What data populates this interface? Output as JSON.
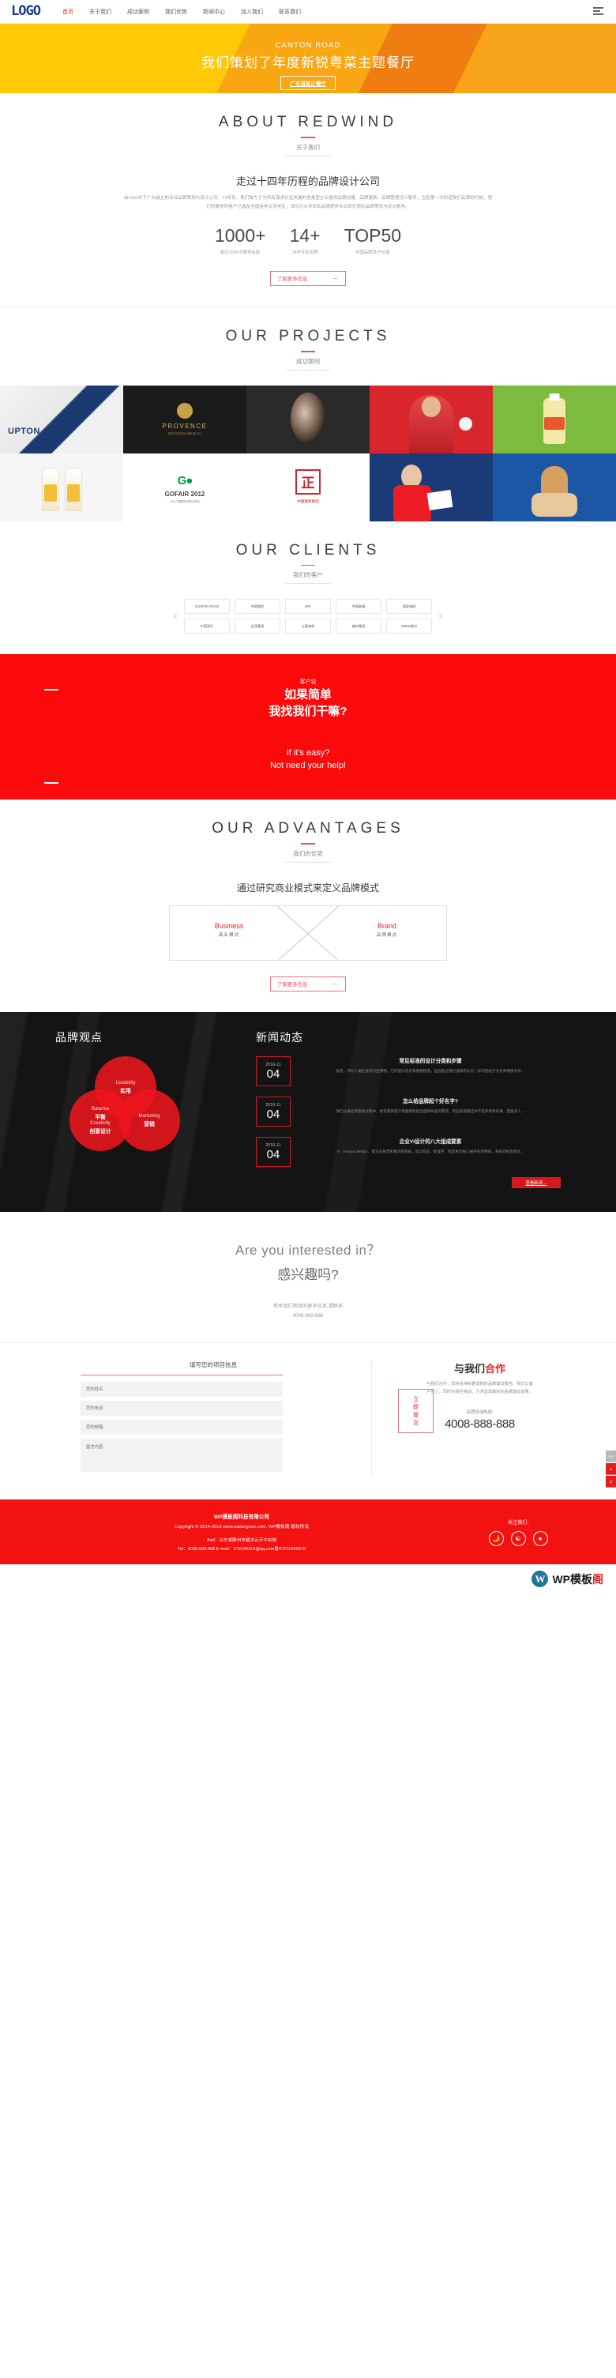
{
  "header": {
    "logo": "LOGO",
    "nav": [
      {
        "label": "首页",
        "active": true
      },
      {
        "label": "关于我们",
        "active": false
      },
      {
        "label": "成功案例",
        "active": false
      },
      {
        "label": "我们优势",
        "active": false
      },
      {
        "label": "新闻中心",
        "active": false
      },
      {
        "label": "加入我们",
        "active": false
      },
      {
        "label": "联系我们",
        "active": false
      }
    ],
    "menu_icon": "hamburger-icon"
  },
  "hero": {
    "eyebrow": "CANTON ROAD",
    "headline": "我们策划了年度新锐粤菜主题餐厅",
    "button": "广东道至正餐厅"
  },
  "about": {
    "title": "ABOUT REDWIND",
    "subtitle": "关于我们",
    "heading": "走过十四年历程的品牌设计公司",
    "paragraph": "由2001年于广州成立的专业品牌策划与设计公司。14年来，我们致力于为所有谋求长远发展的各类型企业提供品牌创建、品牌更新、品牌管理设计服务，当您第一次知道我们品牌的时候，我们所服务的客户已遍及全国各地众多地区，成功为众多知名品牌提供专业而优质的品牌策划与设计服务。",
    "stats": [
      {
        "num": "1000+",
        "label": "超过1000次服务经验"
      },
      {
        "num": "14+",
        "label": "14年专业历程"
      },
      {
        "num": "TOP50",
        "label": "中国品牌设计50强"
      }
    ],
    "more_button": "了解更多信息",
    "more_arrow": "→"
  },
  "projects": {
    "title": "OUR PROJECTS",
    "subtitle": "成功案例",
    "items": [
      {
        "name": "UPTON",
        "sub": ""
      },
      {
        "name": "PROVENCE",
        "sub": "普罗旺斯花园品牌形象设计"
      },
      {
        "name": "",
        "sub": ""
      },
      {
        "name": "",
        "sub": ""
      },
      {
        "name": "",
        "sub": ""
      },
      {
        "name": "",
        "sub": ""
      },
      {
        "name": "GOFAIR 2012",
        "sub": "2012中国国际贸易交易会"
      },
      {
        "name": "正",
        "sub": "中国烟草集团"
      },
      {
        "name": "",
        "sub": ""
      },
      {
        "name": "",
        "sub": ""
      }
    ]
  },
  "clients": {
    "title": "OUR CLIENTS",
    "subtitle": "我们的客户",
    "prev_arrow": "‹",
    "next_arrow": "›",
    "row1": [
      "CANTON ROAD",
      "中国电信",
      "SKF",
      "中国联通",
      "国家电网"
    ],
    "row2": [
      "中国银行",
      "金茂集团",
      "三菱电机",
      "美的集团",
      "GREE格力"
    ]
  },
  "quote": {
    "sub": "客户说",
    "line1": "如果简单",
    "line2": "我找我们干嘛?",
    "en1": "If it's easy?",
    "en2": "Not need your help!"
  },
  "advantages": {
    "title": "OUR ADVANTAGES",
    "subtitle": "我们的优势",
    "heading": "通过研究商业模式来定义品牌模式",
    "left": {
      "en": "Business",
      "cn": "商业模式"
    },
    "right": {
      "en": "Brand",
      "cn": "品牌模式"
    },
    "more_button": "了解更多信息",
    "more_arrow": "→"
  },
  "brandviews": {
    "title": "品牌观点",
    "circles": [
      {
        "en": "Ustability",
        "cn": "实用"
      },
      {
        "en": "Balance",
        "cn": "平衡",
        "en2": "Creativity",
        "cn2": "创意设计"
      },
      {
        "en": "Marketing",
        "cn": "营销"
      }
    ],
    "c1_en": "Ustability",
    "c1_cn": "实用",
    "c2_en": "Balance",
    "c2_cn": "平衡",
    "c2b_en": "Creativity",
    "c2b_cn": "创意设计",
    "c3_en": "Marketing",
    "c3_cn": "营销"
  },
  "news": {
    "title": "新闻动态",
    "items": [
      {
        "ym": "2016-11",
        "d": "04",
        "title": "常见标准的设计分类和步骤",
        "desc": "标志，作为人类社会的衍生物物，它的悠久历史和重要程度，远远超过我们通常的认识。标识起始于文化和物质条件…"
      },
      {
        "ym": "2016-11",
        "d": "04",
        "title": "怎么给品牌起个好名字?",
        "desc": "我们从事品牌策划过程中，经常遇到客户或者朋友提出品牌命名的需求，有些很遗憾这并不是件简单的事，但很多人…"
      },
      {
        "ym": "2016-11",
        "d": "04",
        "title": "企业VI设计的八大组成要素",
        "desc": "VI（Visual Identity），即企业视觉形象识别系统，是以标志、标准字、标准色为核心展开的完整的、系统的视觉表达…"
      }
    ],
    "more": "查看新闻→"
  },
  "interest": {
    "en": "Are you interested in？",
    "cn": "感兴趣吗?",
    "line1": "有关我们项目的更多信息,请联系",
    "line2": "4008-888-888"
  },
  "contact": {
    "form_title": "填写您的项目信息",
    "fields": [
      {
        "name": "name",
        "placeholder": "您的姓名"
      },
      {
        "name": "phone",
        "placeholder": "您的电话"
      },
      {
        "name": "email",
        "placeholder": "您的邮箱"
      }
    ],
    "message_placeholder": "留言内容",
    "submit": "立即提交",
    "right_title_1": "与我们",
    "right_title_2": "合作",
    "right_paragraph": "与我们合作，您将会得到更成熟的品牌建设服务。我们以客户至上，同时也相互挑战，力求呈现最好的品牌建设成果。",
    "hotline_label": "品牌咨询热线:",
    "hotline": "4008-888-888"
  },
  "footer": {
    "company": "WP模板阁科技有限公司",
    "copyright": "Copyright © 2014-2016 www.aiwangxue.com. WP模板阁 版权所有",
    "address": "Add：山东省滕州市碧水云天中央城",
    "contact_line": "Tel：4008-888-888  E-mail：379144319@qq.com鲁ICP12345678",
    "follow_label": "关注我们:",
    "socials": [
      "weibo-icon",
      "wechat-icon",
      "qq-icon"
    ],
    "rail": [
      "TOP",
      "♠",
      "◷"
    ],
    "watermark_w": "W",
    "watermark_text": "WP模板",
    "watermark_accent": "阁"
  },
  "colors": {
    "brand_red": "#e8222a",
    "hero_yellow": "#FFC907",
    "hero_orange": "#EF7D12",
    "logo_blue": "#1a3a8f",
    "quote_red": "#fa0a0a"
  }
}
